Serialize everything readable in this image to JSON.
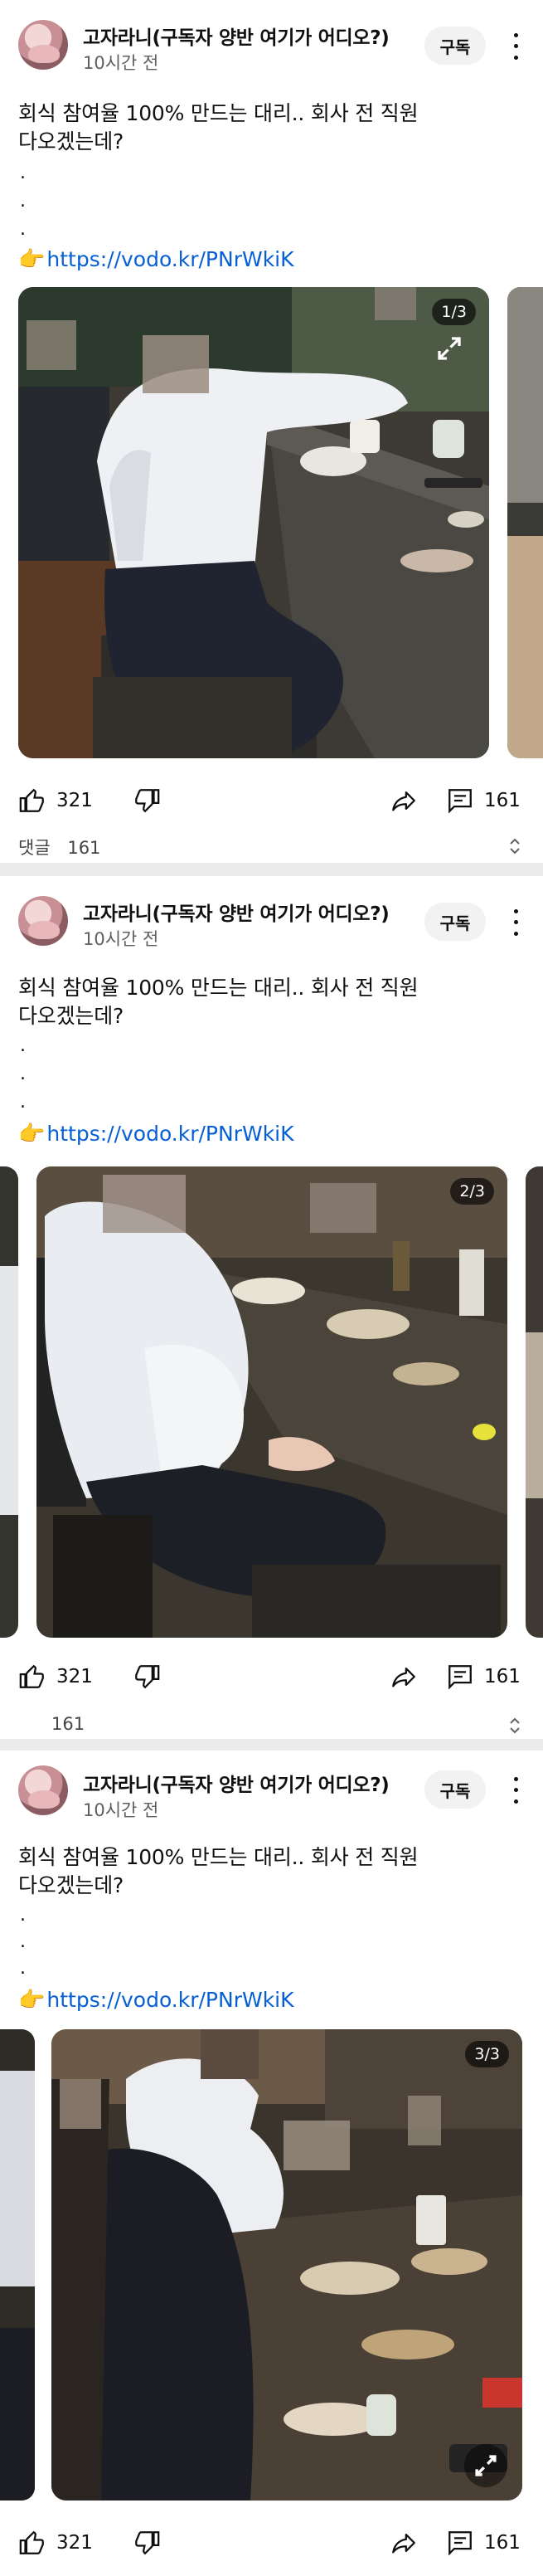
{
  "post": {
    "channel": "고자라니(구독자 양반 여기가 어디오?)",
    "time": "10시간 전",
    "subscribe_label": "구독",
    "title_line1": "회식 참여율 100% 만드는 대리.. 회사 전 직원",
    "title_line2": "다오겠는데?",
    "dots": [
      ".",
      ".",
      "."
    ],
    "link_emoji": "👉",
    "link": "https://vodo.kr/PNrWkiK",
    "likes": "321",
    "comments": "161",
    "comment_row_label": "댓글",
    "comment_row_count": "161",
    "comment_row_count_partial": "161"
  },
  "slides": [
    {
      "counter": "1/3"
    },
    {
      "counter": "2/3"
    },
    {
      "counter": "3/3"
    }
  ],
  "icons": [
    "avatar",
    "more-vert-icon",
    "expand-icon",
    "thumb-up-icon",
    "thumb-down-icon",
    "share-icon",
    "comment-icon",
    "chevron-icon"
  ],
  "colors": {
    "link": "#065fd4",
    "separator": "#ececec",
    "subscribe_bg": "#f2f2f2"
  }
}
